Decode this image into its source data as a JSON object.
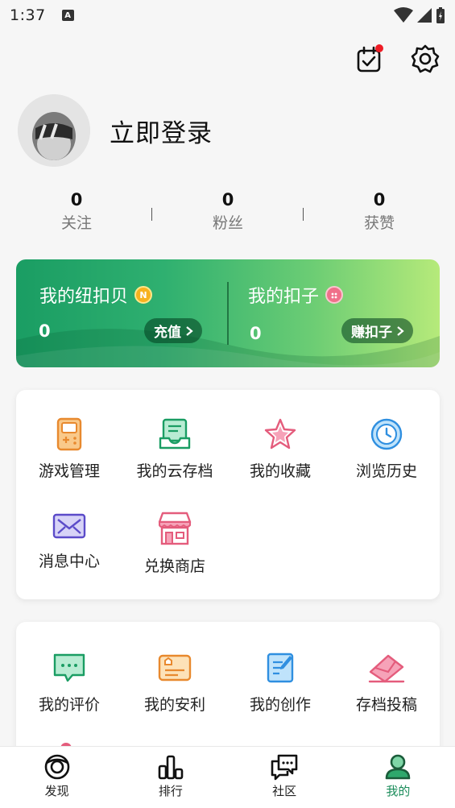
{
  "status_bar": {
    "time": "1:37",
    "a_badge": "A"
  },
  "profile": {
    "login_label": "立即登录"
  },
  "stats": [
    {
      "count": "0",
      "label": "关注"
    },
    {
      "count": "0",
      "label": "粉丝"
    },
    {
      "count": "0",
      "label": "获赞"
    }
  ],
  "wallet": {
    "niukoubei": {
      "title": "我的纽扣贝",
      "coin_letter": "N",
      "value": "0",
      "button": "充值"
    },
    "kouzi": {
      "title": "我的扣子",
      "value": "0",
      "button": "赚扣子"
    }
  },
  "services": [
    {
      "label": "游戏管理",
      "icon": "game-console-icon"
    },
    {
      "label": "我的云存档",
      "icon": "cloud-save-icon"
    },
    {
      "label": "我的收藏",
      "icon": "star-icon"
    },
    {
      "label": "浏览历史",
      "icon": "clock-icon"
    },
    {
      "label": "消息中心",
      "icon": "mail-icon"
    },
    {
      "label": "兑换商店",
      "icon": "store-icon"
    }
  ],
  "creations": [
    {
      "label": "我的评价",
      "icon": "comment-icon"
    },
    {
      "label": "我的安利",
      "icon": "recommend-card-icon"
    },
    {
      "label": "我的创作",
      "icon": "edit-doc-icon"
    },
    {
      "label": "存档投稿",
      "icon": "envelope-submit-icon"
    }
  ],
  "tabbar": [
    {
      "label": "发现",
      "icon": "discover-icon",
      "active": false
    },
    {
      "label": "排行",
      "icon": "ranking-icon",
      "active": false
    },
    {
      "label": "社区",
      "icon": "community-icon",
      "active": false
    },
    {
      "label": "我的",
      "icon": "user-icon",
      "active": true
    }
  ],
  "colors": {
    "accent": "#1a8c5a",
    "badge_red": "#ee1c25"
  }
}
